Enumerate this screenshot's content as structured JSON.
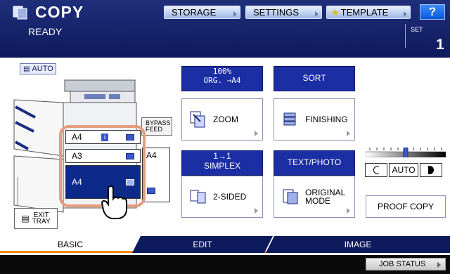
{
  "header": {
    "app_title": "COPY",
    "status": "READY",
    "set_label": "SET",
    "set_count": "1",
    "buttons": {
      "storage": "STORAGE",
      "settings": "SETTINGS",
      "template": "TEMPLATE",
      "help": "?"
    }
  },
  "left_panel": {
    "auto_label": "AUTO",
    "trays": {
      "tray1": "A4",
      "tray2": "A3",
      "tray3": "A4"
    },
    "bypass_label_1": "BYPASS",
    "bypass_label_2": "FEED",
    "bypass_paper": "A4",
    "exit_tray_1": "EXIT",
    "exit_tray_2": "TRAY"
  },
  "zoom": {
    "info_line1": "100%",
    "info_line2": "ORG. →A4",
    "button": "ZOOM"
  },
  "finishing": {
    "info_line1": "SORT",
    "button": "FINISHING"
  },
  "duplex": {
    "info_line1": "1→1",
    "info_line2": "SIMPLEX",
    "button": "2-SIDED"
  },
  "original": {
    "info_line1": "TEXT/PHOTO",
    "button_line1": "ORIGINAL",
    "button_line2": "MODE"
  },
  "density": {
    "auto_label": "AUTO"
  },
  "proof_copy": "PROOF COPY",
  "tabs": {
    "basic": "BASIC",
    "edit": "EDIT",
    "image": "IMAGE"
  },
  "footer": {
    "job_status": "JOB STATUS"
  },
  "colors": {
    "header_bg": "#0d1a5c",
    "tab_underline": "#ee8a00",
    "selected_tray": "#0d2a8a",
    "highlight": "#e69b7d"
  }
}
